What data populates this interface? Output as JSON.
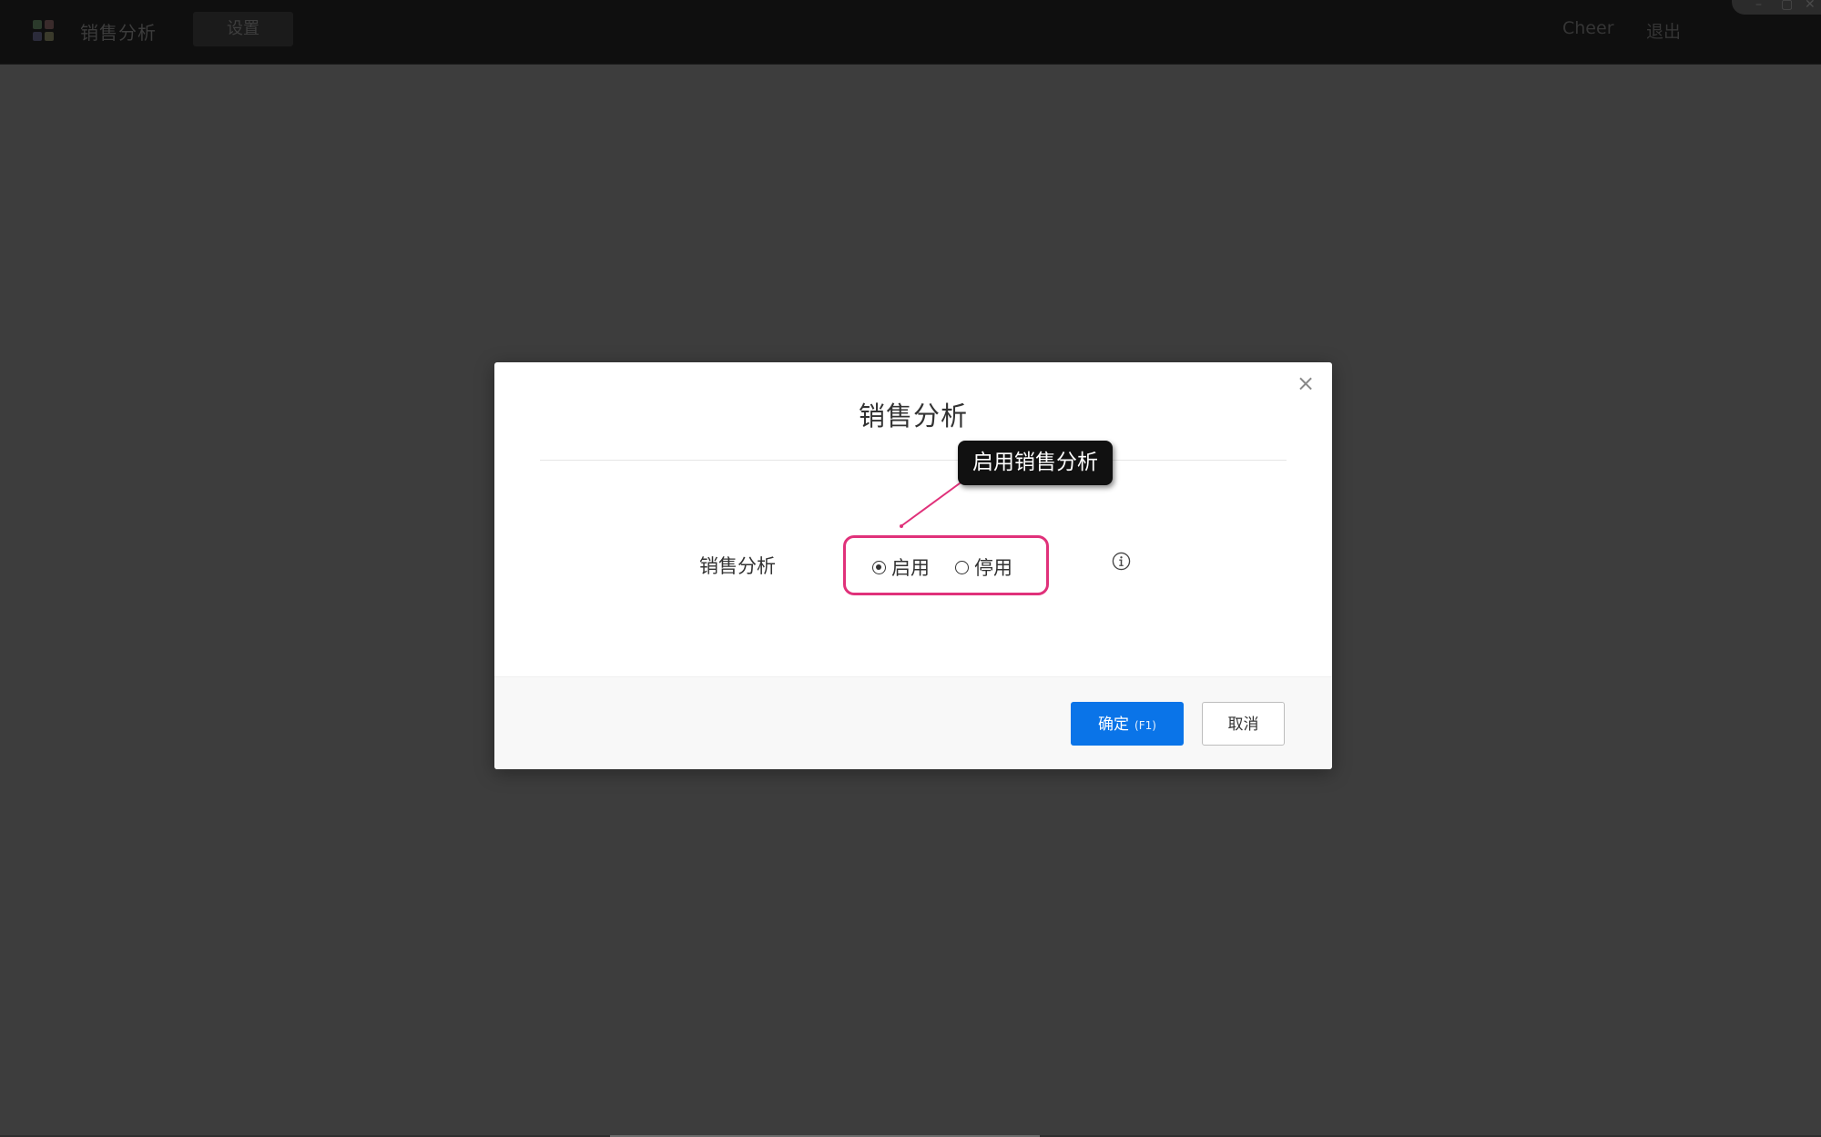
{
  "app": {
    "title": "销售分析",
    "tab_settings": "设置",
    "user_name": "Cheer",
    "logout_label": "退出",
    "window_controls": [
      "–",
      "▢",
      "✕"
    ]
  },
  "dialog": {
    "title": "销售分析",
    "close_glyph": "×",
    "field_label": "销售分析",
    "options": [
      {
        "label": "启用",
        "checked": true
      },
      {
        "label": "停用",
        "checked": false
      }
    ],
    "tooltip": "启用销售分析",
    "ok_label": "确定",
    "ok_shortcut": "(F1)",
    "cancel_label": "取消"
  },
  "colors": {
    "highlight": "#e0317a",
    "primary": "#0a74e8",
    "overlay": "#3d3d3d"
  },
  "icons": {
    "info": "info-circle-icon",
    "close": "close-icon"
  }
}
